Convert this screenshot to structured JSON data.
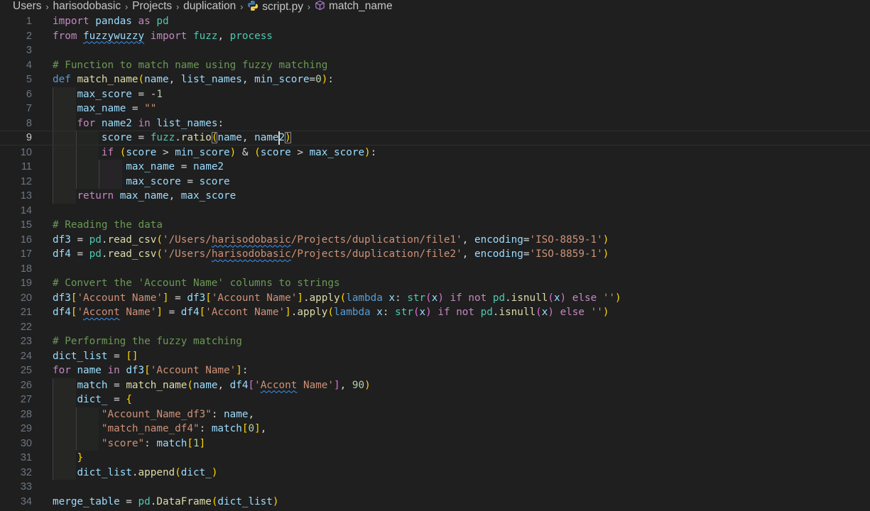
{
  "breadcrumb": {
    "items": [
      "Users",
      "harisodobasic",
      "Projects",
      "duplication",
      "script.py",
      "match_name"
    ],
    "separator": "›"
  },
  "editor": {
    "language": "python",
    "current_line": 9,
    "lines": [
      "import pandas as pd",
      "from fuzzywuzzy import fuzz, process",
      "",
      "# Function to match name using fuzzy matching",
      "def match_name(name, list_names, min_score=0):",
      "    max_score = -1",
      "    max_name = \"\"",
      "    for name2 in list_names:",
      "        score = fuzz.ratio(name, name2)",
      "        if (score > min_score) & (score > max_score):",
      "            max_name = name2",
      "            max_score = score",
      "    return max_name, max_score",
      "",
      "# Reading the data",
      "df3 = pd.read_csv('/Users/harisodobasic/Projects/duplication/file1', encoding='ISO-8859-1')",
      "df4 = pd.read_csv('/Users/harisodobasic/Projects/duplication/file2', encoding='ISO-8859-1')",
      "",
      "# Convert the 'Account Name' columns to strings",
      "df3['Account Name'] = df3['Account Name'].apply(lambda x: str(x) if not pd.isnull(x) else '')",
      "df4['Accont Name'] = df4['Accont Name'].apply(lambda x: str(x) if not pd.isnull(x) else '')",
      "",
      "# Performing the fuzzy matching",
      "dict_list = []",
      "for name in df3['Account Name']:",
      "    match = match_name(name, df4['Accont Name'], 90)",
      "    dict_ = {",
      "        \"Account_Name_df3\": name,",
      "        \"match_name_df4\": match[0],",
      "        \"score\": match[1]",
      "    }",
      "    dict_list.append(dict_)",
      "",
      "merge_table = pd.DataFrame(dict_list)"
    ],
    "squiggles": [
      {
        "line": 2,
        "text": "fuzzywuzzy"
      },
      {
        "line": 16,
        "text": "harisodobasic"
      },
      {
        "line": 17,
        "text": "harisodobasic"
      },
      {
        "line": 21,
        "text": "Accont"
      },
      {
        "line": 26,
        "text": "Accont"
      }
    ],
    "icons": [
      "python-file-icon",
      "symbol-method-icon"
    ]
  }
}
